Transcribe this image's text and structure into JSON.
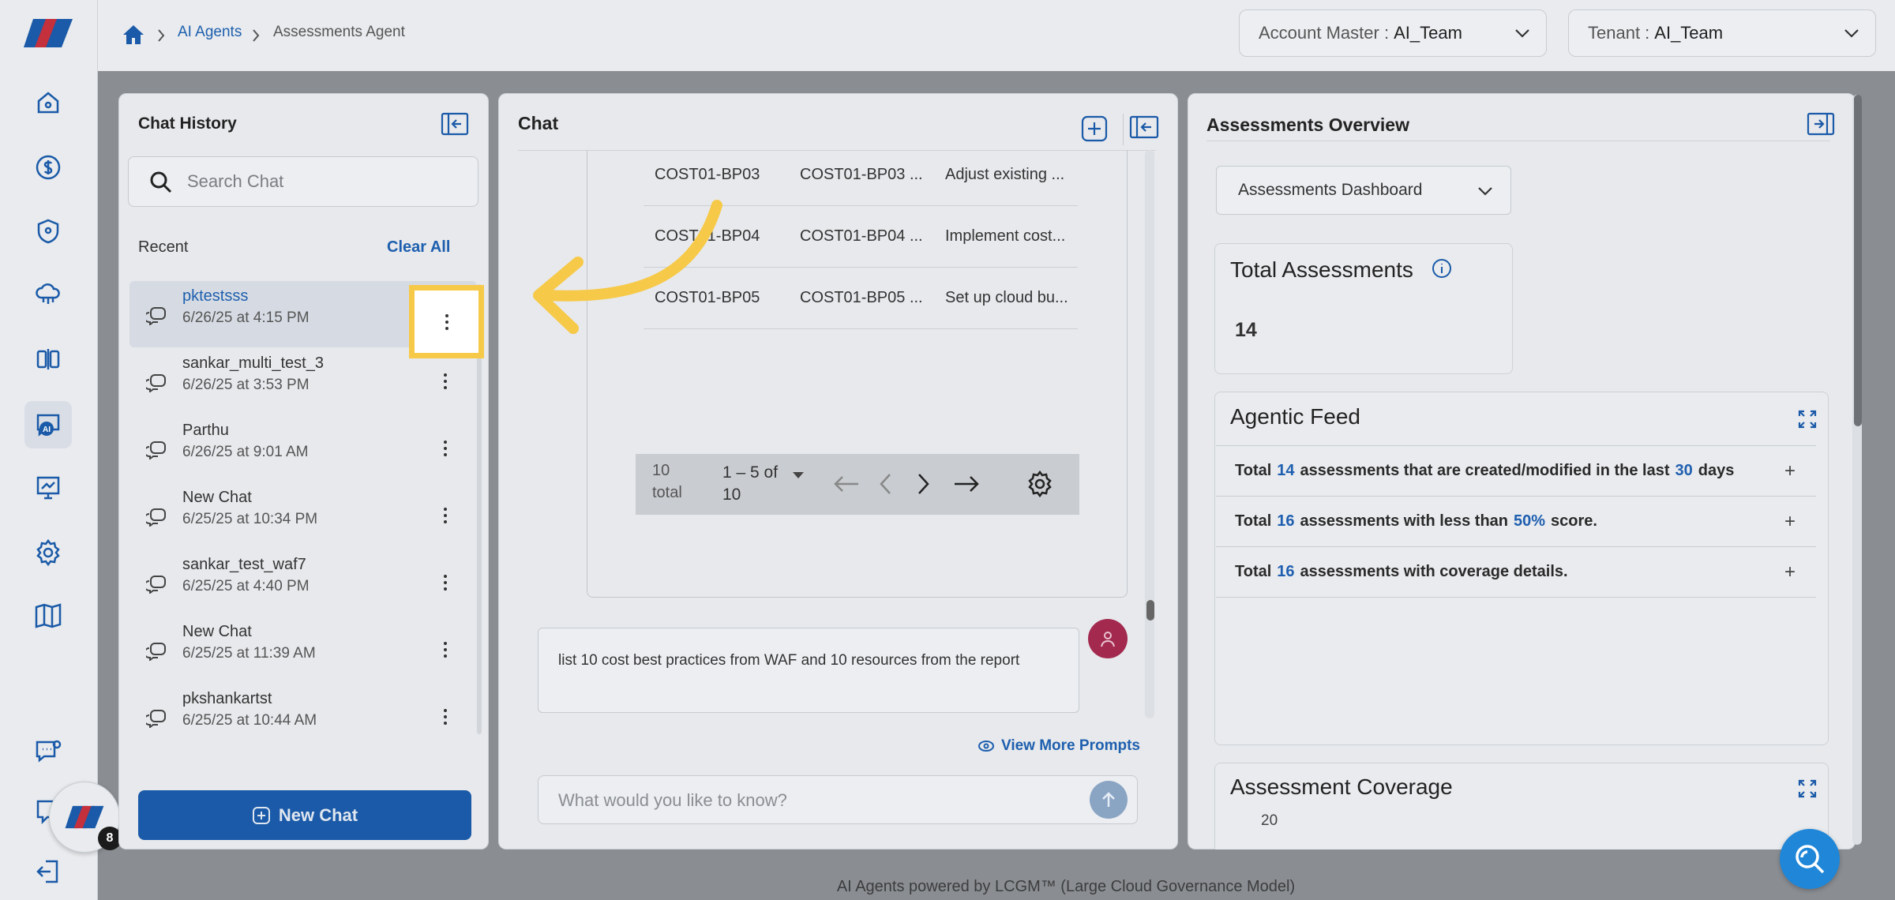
{
  "breadcrumb": {
    "home": "home-icon",
    "items": [
      "AI Agents",
      "Assessments Agent"
    ]
  },
  "header": {
    "account_label": "Account Master :",
    "account_value": "AI_Team",
    "tenant_label": "Tenant :",
    "tenant_value": "AI_Team"
  },
  "sidebar": {
    "icons": [
      "home-icon",
      "dollar-icon",
      "shield-icon",
      "cloud-network-icon",
      "compare-icon",
      "ai-agents-icon",
      "presentation-icon",
      "gear-icon",
      "book-icon",
      "chat-help-icon",
      "user-chat-icon",
      "logout-icon"
    ],
    "notification_count": "8"
  },
  "chat_history": {
    "title": "Chat History",
    "search_placeholder": "Search Chat",
    "recent_label": "Recent",
    "clear_all": "Clear All",
    "items": [
      {
        "title": "pktestsss",
        "date": "6/26/25 at 4:15 PM"
      },
      {
        "title": "sankar_multi_test_3",
        "date": "6/26/25 at 3:53 PM"
      },
      {
        "title": "Parthu",
        "date": "6/26/25 at 9:01 AM"
      },
      {
        "title": "New Chat",
        "date": "6/25/25 at 10:34 PM"
      },
      {
        "title": "sankar_test_waf7",
        "date": "6/25/25 at 4:40 PM"
      },
      {
        "title": "New Chat",
        "date": "6/25/25 at 11:39 AM"
      },
      {
        "title": "pkshankartst",
        "date": "6/25/25 at 10:44 AM"
      }
    ],
    "new_chat": "New Chat"
  },
  "chat": {
    "title": "Chat",
    "table_rows": [
      [
        "COST01-BP03",
        "COST01-BP03 ...",
        "Adjust existing ..."
      ],
      [
        "COST01-BP04",
        "COST01-BP04 ...",
        "Implement cost..."
      ],
      [
        "COST01-BP05",
        "COST01-BP05 ...",
        "Set up cloud bu..."
      ]
    ],
    "pager": {
      "total_num": "10",
      "total_word": "total",
      "range": "1 – 5 of",
      "range2": "10"
    },
    "user_message": "list 10 cost best practices from WAF and 10 resources from the report",
    "view_more": "View More Prompts",
    "input_placeholder": "What would you like to know?"
  },
  "overview": {
    "title": "Assessments Overview",
    "dashboard_select": "Assessments Dashboard",
    "total_title": "Total Assessments",
    "total_value": "14",
    "feed_title": "Agentic Feed",
    "feed": [
      {
        "pre": "Total",
        "n1": "14",
        "mid": "assessments that are created/modified in the last",
        "n2": "30",
        "post": "days"
      },
      {
        "pre": "Total",
        "n1": "16",
        "mid": "assessments with less than",
        "n2": "50%",
        "post": "score."
      },
      {
        "pre": "Total",
        "n1": "16",
        "mid": "assessments with coverage details.",
        "n2": "",
        "post": ""
      }
    ],
    "coverage_title": "Assessment Coverage",
    "coverage_tick": "20"
  },
  "footer": "AI Agents powered by LCGM™ (Large Cloud Governance Model)",
  "colors": {
    "brand_blue": "#1a5aa8",
    "highlight": "#f7c948"
  }
}
